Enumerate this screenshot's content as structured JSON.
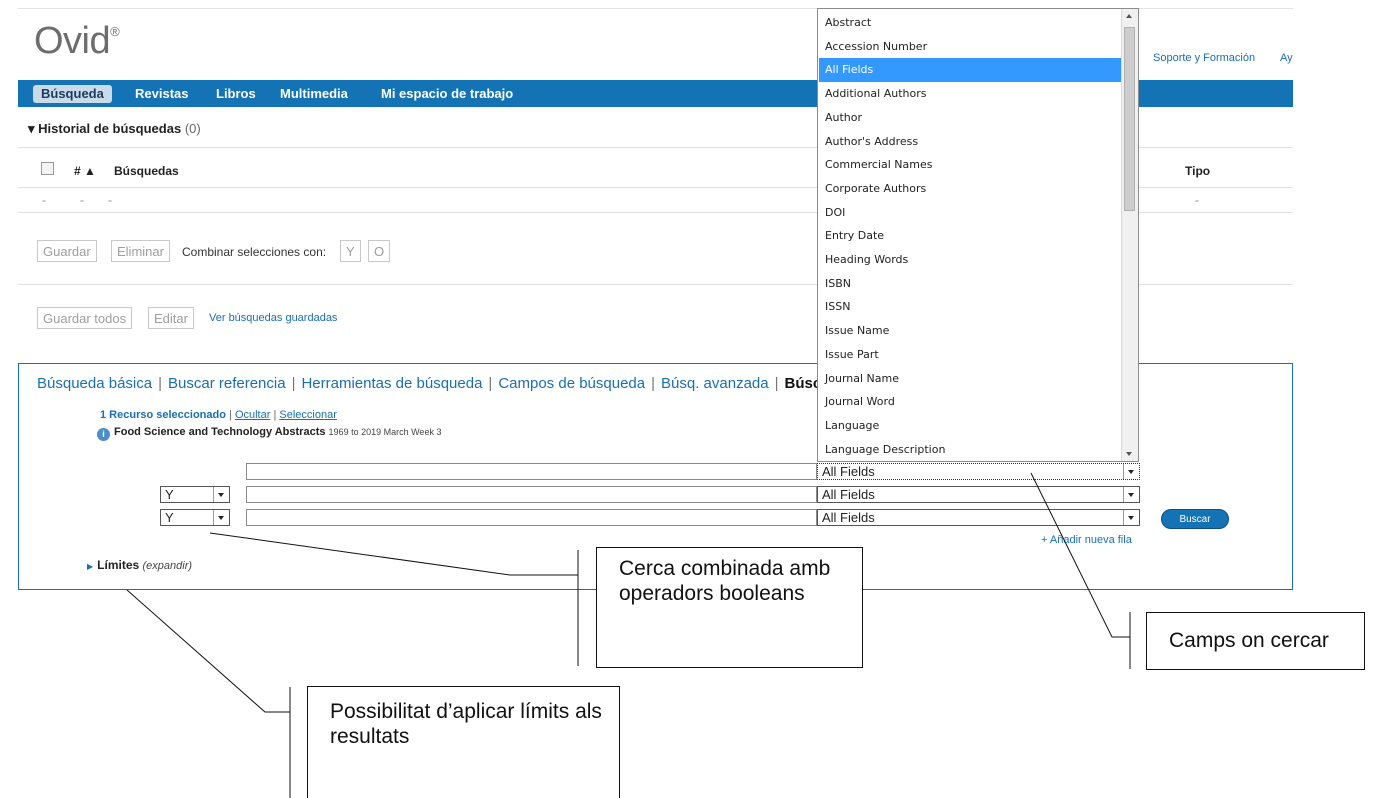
{
  "header": {
    "logo": "Ovid",
    "logo_mark": "®",
    "links": [
      "Soporte y Formación",
      "Ay"
    ]
  },
  "nav": {
    "items": [
      "Búsqueda",
      "Revistas",
      "Libros",
      "Multimedia",
      "Mi espacio de trabajo"
    ],
    "active": "Búsqueda"
  },
  "history": {
    "title": "Historial de búsquedas",
    "count": "(0)",
    "columns": {
      "num": "# ▲",
      "searches": "Búsquedas",
      "type": "Tipo"
    },
    "empty_row": [
      "-",
      "-",
      "-",
      "-"
    ],
    "buttons": {
      "save": "Guardar",
      "delete": "Eliminar",
      "combine_label": "Combinar selecciones con:",
      "and": "Y",
      "or": "O"
    },
    "bottom_buttons": {
      "save_all": "Guardar todos",
      "edit": "Editar",
      "view_saved": "Ver búsquedas guardadas"
    }
  },
  "search_panel": {
    "tabs": [
      "Búsqueda básica",
      "Buscar referencia",
      "Herramientas de búsqueda",
      "Campos de búsqueda",
      "Búsq. avanzada",
      "Búsc"
    ],
    "resource_selected": "1 Recurso seleccionado",
    "hide": "Ocultar",
    "select": "Seleccionar",
    "database_name": "Food Science and Technology Abstracts",
    "database_years": "1969 to 2019 March Week 3",
    "rows": [
      {
        "operator": "",
        "term": "",
        "field": "All Fields"
      },
      {
        "operator": "Y",
        "term": "",
        "field": "All Fields"
      },
      {
        "operator": "Y",
        "term": "",
        "field": "All Fields"
      }
    ],
    "search_button": "Buscar",
    "add_row": "+ Añadir nueva fila",
    "limits": "Límites",
    "limits_expand": "(expandir)"
  },
  "field_dropdown": {
    "options": [
      "Abstract",
      "Accession Number",
      "All Fields",
      "Additional Authors",
      "Author",
      "Author's Address",
      "Commercial Names",
      "Corporate Authors",
      "DOI",
      "Entry Date",
      "Heading Words",
      "ISBN",
      "ISSN",
      "Issue Name",
      "Issue Part",
      "Journal Name",
      "Journal Word",
      "Language",
      "Language Description"
    ],
    "highlighted": "All Fields"
  },
  "annotations": {
    "boolean": "Cerca combinada amb operadors booleans",
    "fields": "Camps on cercar",
    "limits": "Possibilitat d’aplicar límits als resultats"
  },
  "colors": {
    "nav_blue": "#1473b5",
    "link_blue": "#1a6fb0",
    "highlight": "#3399ff"
  }
}
